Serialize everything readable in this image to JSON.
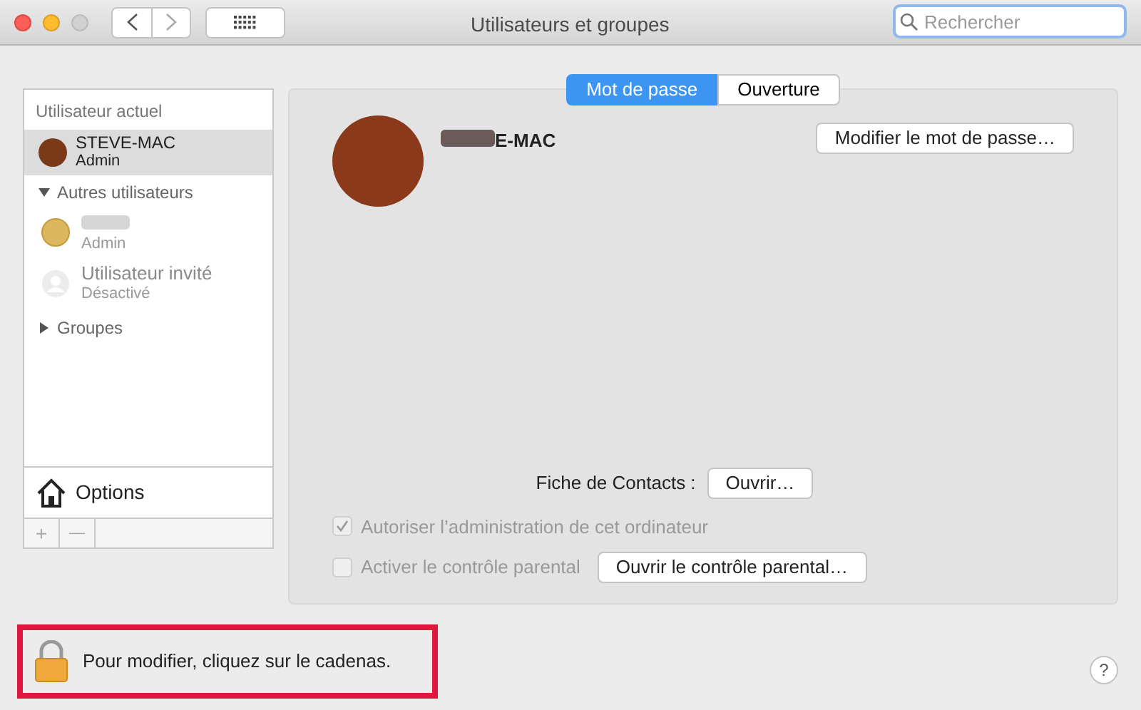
{
  "window": {
    "title": "Utilisateurs et groupes",
    "search": {
      "placeholder": "Rechercher"
    }
  },
  "tabs": [
    {
      "label": "Mot de passe",
      "selected": true
    },
    {
      "label": "Ouverture",
      "selected": false
    }
  ],
  "sidebar": {
    "current_header": "Utilisateur actuel",
    "current_user": {
      "name": "STEVE-MAC",
      "role": "Admin",
      "selected": true
    },
    "others_header": {
      "label": "Autres utilisateurs",
      "expanded": true
    },
    "other_users": [
      {
        "kind": "coin",
        "role": "Admin"
      },
      {
        "kind": "guest",
        "name": "Utilisateur invité",
        "role": "Désactivé"
      }
    ],
    "groups": {
      "label": "Groupes",
      "expanded": false
    },
    "options": "Options",
    "add": "+",
    "remove": "—"
  },
  "user": {
    "name": "E-MAC",
    "change_password": "Modifier le mot de passe…"
  },
  "contacts": {
    "label": "Fiche de Contacts :",
    "button": "Ouvrir…"
  },
  "checks": [
    {
      "label": "Autoriser l’administration de cet ordinateur",
      "checked": true,
      "disabled": true
    },
    {
      "label": "Activer le contrôle parental",
      "checked": false,
      "disabled": true,
      "button": "Ouvrir le contrôle parental…"
    }
  ],
  "lock": {
    "text": "Pour modifier, cliquez sur le cadenas."
  },
  "help": "?"
}
